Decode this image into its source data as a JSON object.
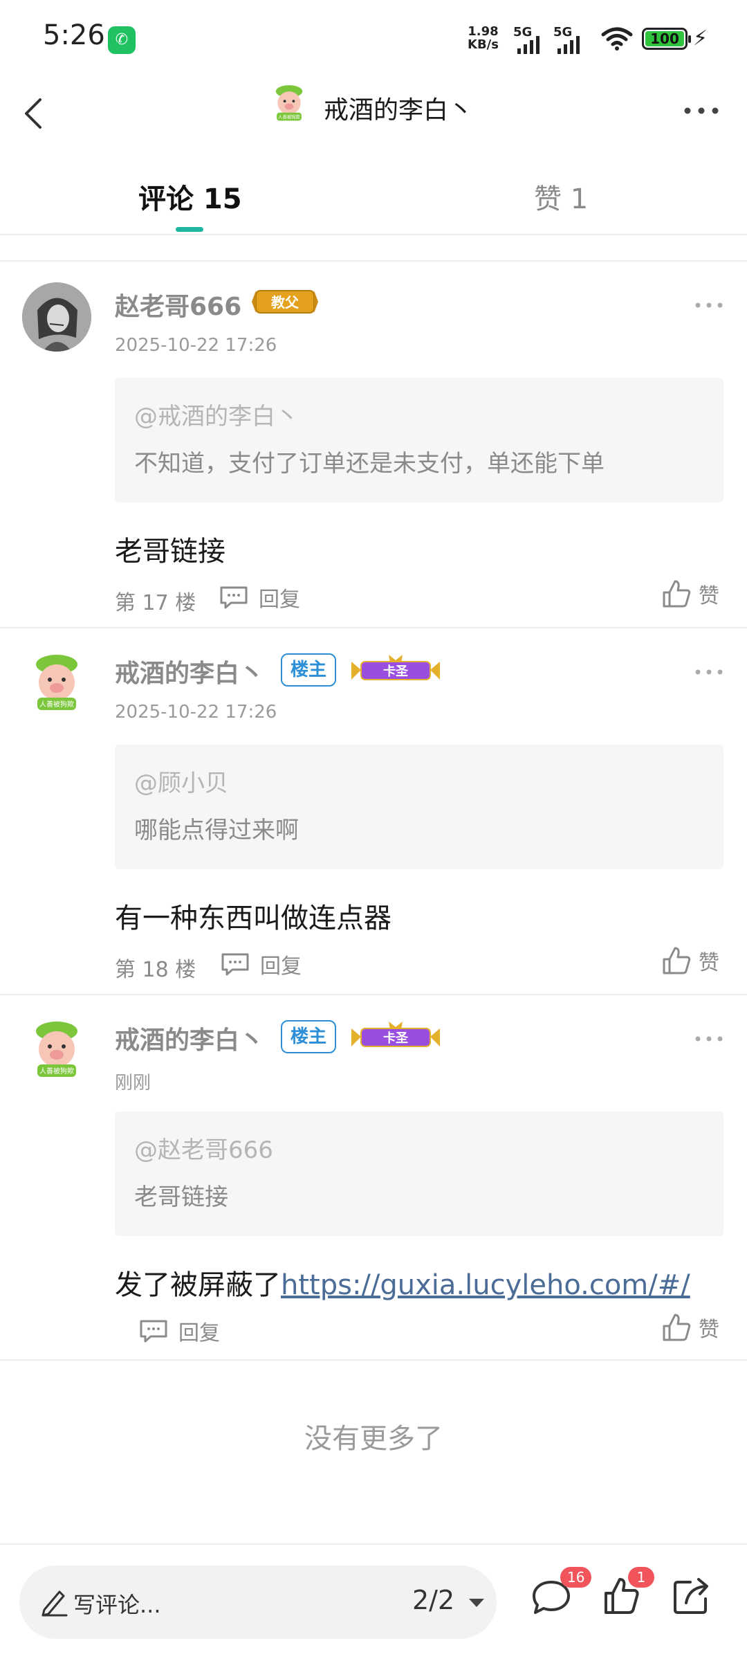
{
  "status_bar": {
    "time": "5:26",
    "wechat_glyph": "✆",
    "net_speed_value": "1.98",
    "net_speed_unit": "KB/s",
    "signal_1_label": "5G",
    "signal_2_label": "5G",
    "battery": "100",
    "bolt": "⚡"
  },
  "header": {
    "title": "戒酒的李白丶",
    "avatar_text": "人善被狗欺"
  },
  "tabs": {
    "comments_label": "评论 15",
    "likes_label": "赞 1"
  },
  "comments": [
    {
      "username": "赵老哥666",
      "title_badge": "教父",
      "time": "2025-10-22 17:26",
      "quote_user": "@戒酒的李白丶",
      "quote_text": "不知道，支付了订单还是未支付，单还能下单",
      "body": "老哥链接",
      "floor": "第 17 楼",
      "reply_label": "回复",
      "like_label": "赞"
    },
    {
      "username": "戒酒的李白丶",
      "owner_badge": "楼主",
      "title_badge": "卡圣",
      "avatar_text": "人善被狗欺",
      "time": "2025-10-22 17:26",
      "quote_user": "@顾小贝",
      "quote_text": "哪能点得过来啊",
      "body": "有一种东西叫做连点器",
      "floor": "第 18 楼",
      "reply_label": "回复",
      "like_label": "赞"
    },
    {
      "username": "戒酒的李白丶",
      "owner_badge": "楼主",
      "title_badge": "卡圣",
      "avatar_text": "人善被狗欺",
      "time": "刚刚",
      "quote_user": "@赵老哥666",
      "quote_text": "老哥链接",
      "body": "发了被屏蔽了",
      "body_link": "https://guxia.lucyleho.com/#/",
      "reply_label": "回复",
      "like_label": "赞"
    }
  ],
  "footer": {
    "no_more": "没有更多了"
  },
  "bottom_bar": {
    "input_placeholder": "写评论...",
    "page_indicator": "2/2",
    "comment_count": "16",
    "like_count": "1"
  },
  "colors": {
    "accent": "#1fb5a0",
    "link": "#4a6c96",
    "owner_badge": "#2b8ed6",
    "notification_badge": "#f2545b",
    "crown_badge": "#9a4ee0"
  }
}
